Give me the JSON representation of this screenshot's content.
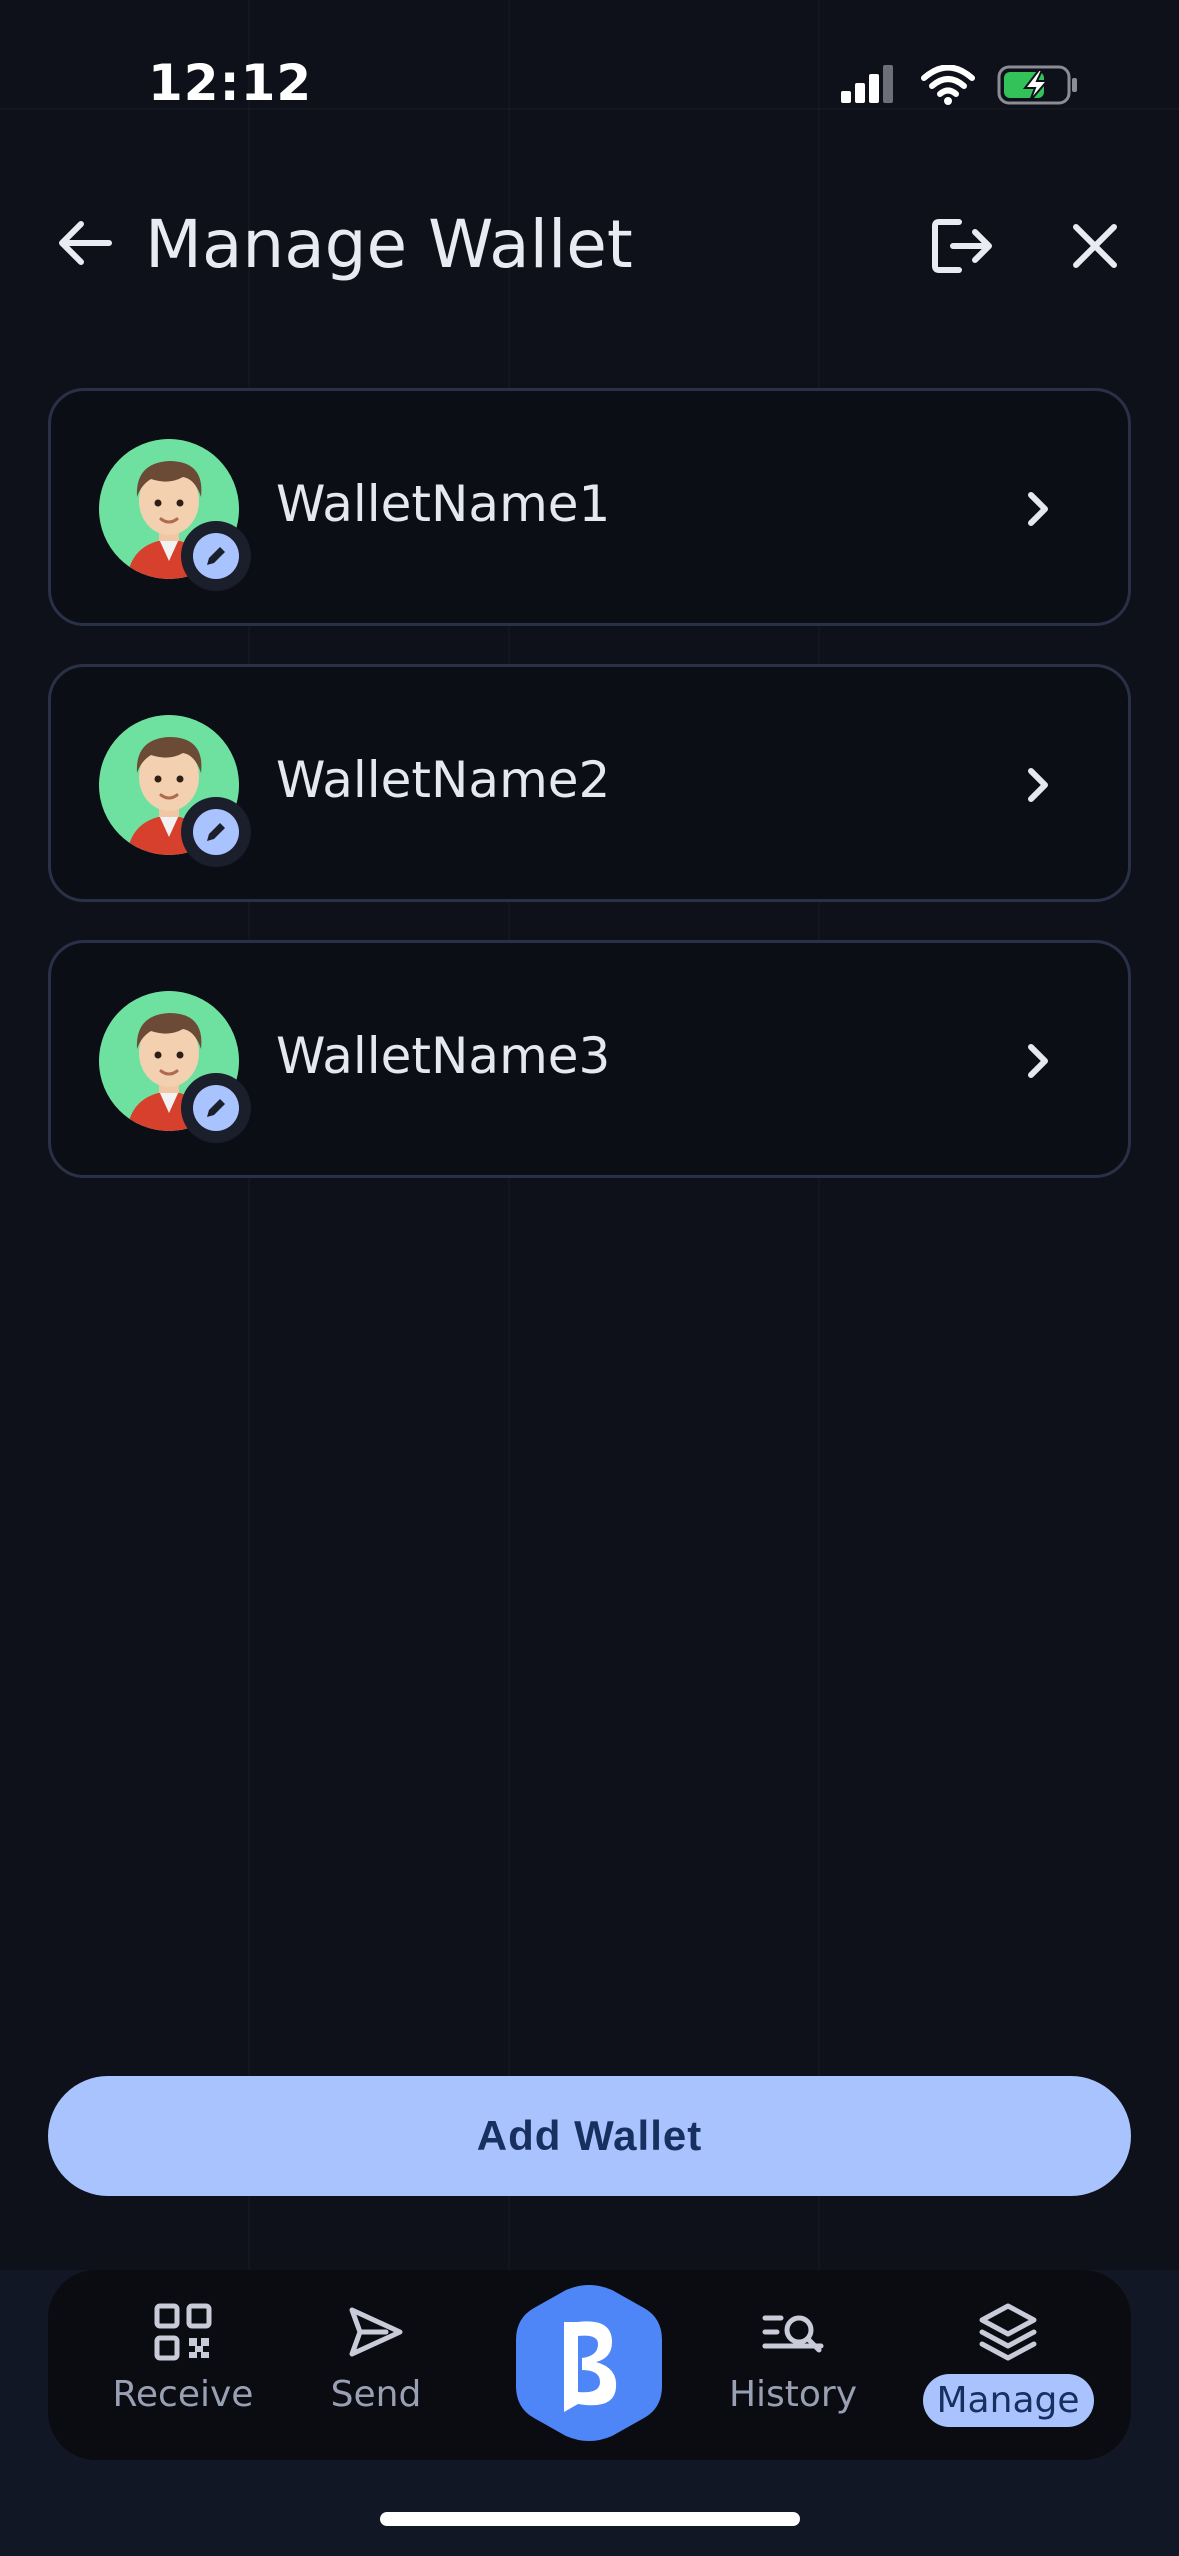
{
  "status_bar": {
    "time": "12:12"
  },
  "header": {
    "title": "Manage Wallet"
  },
  "wallets": [
    {
      "name": "WalletName1"
    },
    {
      "name": "WalletName2"
    },
    {
      "name": "WalletName3"
    }
  ],
  "actions": {
    "add_wallet_label": "Add Wallet"
  },
  "nav": {
    "items": [
      {
        "label": "Receive",
        "icon": "qr-code-icon"
      },
      {
        "label": "Send",
        "icon": "send-icon"
      },
      {
        "label": "History",
        "icon": "history-search-icon"
      },
      {
        "label": "Manage",
        "icon": "layers-icon",
        "active": true
      }
    ],
    "center_icon": "brand-logo-icon"
  },
  "colors": {
    "background": "#0f111a",
    "card_border": "#2a3047",
    "accent": "#a9c3ff",
    "accent_text": "#17305f",
    "brand_blue": "#4f86f7",
    "avatar_bg": "#6ee0a0"
  }
}
